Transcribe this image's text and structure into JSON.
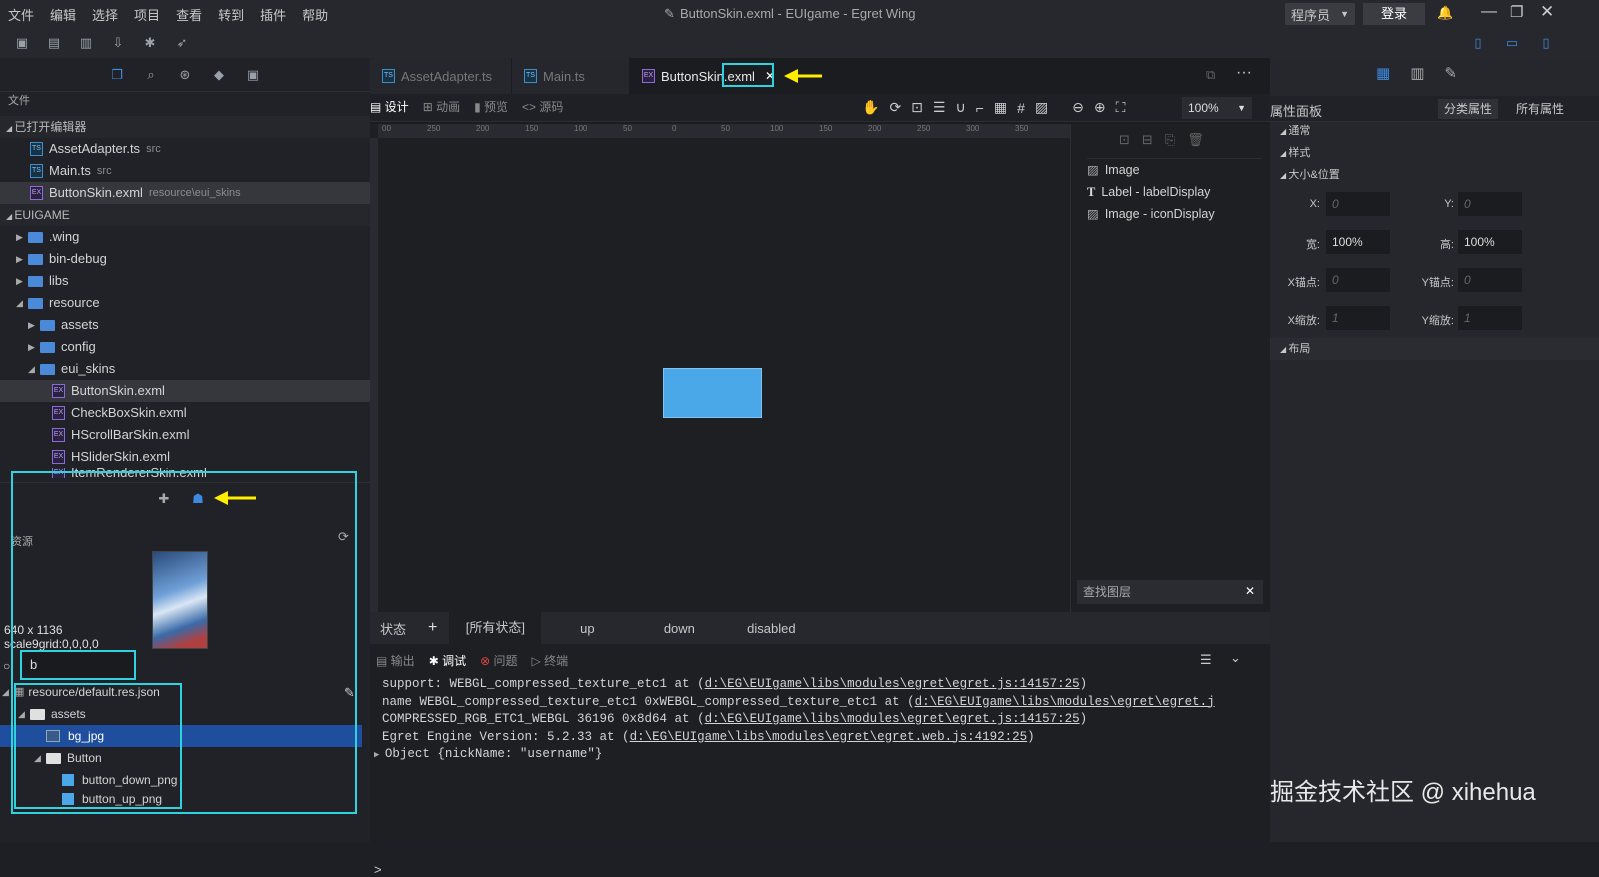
{
  "menu": [
    "文件",
    "编辑",
    "选择",
    "项目",
    "查看",
    "转到",
    "插件",
    "帮助"
  ],
  "window_title": "ButtonSkin.exml - EUIgame - Egret Wing",
  "titlebar": {
    "role": "程序员",
    "login": "登录"
  },
  "left": {
    "header": "文件",
    "open_editors_title": "已打开编辑器",
    "open_editors": [
      {
        "name": "AssetAdapter.ts",
        "sub": "src"
      },
      {
        "name": "Main.ts",
        "sub": "src"
      },
      {
        "name": "ButtonSkin.exml",
        "sub": "resource\\eui_skins"
      }
    ],
    "project_title": "EUIGAME",
    "tree": [
      {
        "name": ".wing"
      },
      {
        "name": "bin-debug"
      },
      {
        "name": "libs"
      },
      {
        "name": "resource"
      },
      {
        "name": "assets"
      },
      {
        "name": "config"
      },
      {
        "name": "eui_skins"
      },
      {
        "name": "ButtonSkin.exml"
      },
      {
        "name": "CheckBoxSkin.exml"
      },
      {
        "name": "HScrollBarSkin.exml"
      },
      {
        "name": "HSliderSkin.exml"
      },
      {
        "name": "ItemRendererSkin.exml"
      }
    ],
    "res_label": "资源",
    "img_size": "640 x 1136",
    "img_grid": "scale9grid:0,0,0,0",
    "search_value": "b",
    "res_tree": [
      {
        "name": "resource/default.res.json"
      },
      {
        "name": "assets"
      },
      {
        "name": "bg_jpg"
      },
      {
        "name": "Button"
      },
      {
        "name": "button_down_png"
      },
      {
        "name": "button_up_png"
      }
    ]
  },
  "tabs": [
    {
      "label": "AssetAdapter.ts"
    },
    {
      "label": "Main.ts"
    },
    {
      "label": "ButtonSkin.exml"
    }
  ],
  "view_modes": [
    "设计",
    "动画",
    "预览",
    "源码"
  ],
  "zoom": "100%",
  "ruler": [
    "00",
    "250",
    "200",
    "150",
    "100",
    "50",
    "0",
    "50",
    "100",
    "150",
    "200",
    "250",
    "300",
    "350"
  ],
  "layers": [
    {
      "label": "Image"
    },
    {
      "label": "Label - labelDisplay"
    },
    {
      "label": "Image - iconDisplay"
    }
  ],
  "layer_search_placeholder": "查找图层",
  "states": {
    "label": "状态",
    "items": [
      "[所有状态]",
      "up",
      "down",
      "disabled"
    ]
  },
  "console_tabs": [
    "输出",
    "调试",
    "问题",
    "终端"
  ],
  "console_lines": [
    {
      "text": "support: WEBGL_compressed_texture_etc1     at ",
      "link": "d:\\EG\\EUIgame\\libs\\modules\\egret\\egret.js:14157:25",
      "tail": ")"
    },
    {
      "text": "name WEBGL_compressed_texture_etc1 0xWEBGL_compressed_texture_etc1     at ",
      "link": "d:\\EG\\EUIgame\\libs\\modules\\egret\\egret.j",
      "tail": ""
    },
    {
      "text": "COMPRESSED_RGB_ETC1_WEBGL 36196 0x8d64     at ",
      "link": "d:\\EG\\EUIgame\\libs\\modules\\egret\\egret.js:14157:25",
      "tail": ")"
    },
    {
      "text": "Egret Engine Version: 5.2.33     at ",
      "link": "d:\\EG\\EUIgame\\libs\\modules\\egret\\egret.web.js:4192:25",
      "tail": ")"
    },
    {
      "text": "Object {nickName: \"username\"}",
      "link": "",
      "tail": ""
    }
  ],
  "props": {
    "title": "属性面板",
    "btn_category": "分类属性",
    "btn_all": "所有属性",
    "sections": [
      "通常",
      "样式",
      "大小&位置",
      "布局"
    ],
    "fields": {
      "x_label": "X:",
      "x": "0",
      "y_label": "Y:",
      "y": "0",
      "w_label": "宽:",
      "w": "100%",
      "h_label": "高:",
      "h": "100%",
      "ax_label": "X锚点:",
      "ax": "0",
      "ay_label": "Y锚点:",
      "ay": "0",
      "sx_label": "X缩放:",
      "sx": "1",
      "sy_label": "Y缩放:",
      "sy": "1"
    }
  },
  "watermark": "掘金技术社区 @ xihehua",
  "colors": {
    "highlight": "#2ed3df",
    "arrow": "#ffee00",
    "selection": "#1f4e9e",
    "button_fill": "#4aa8e8"
  }
}
